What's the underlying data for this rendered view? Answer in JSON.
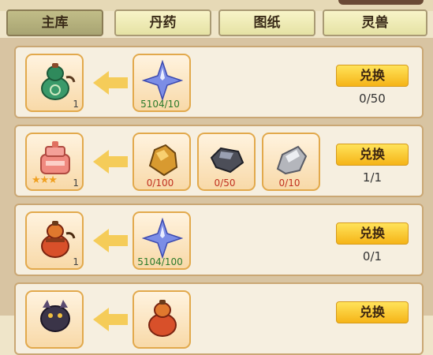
{
  "tabs": [
    {
      "label": "主库"
    },
    {
      "label": "丹药"
    },
    {
      "label": "图纸"
    },
    {
      "label": "灵兽"
    }
  ],
  "rows": [
    {
      "target": {
        "icon": "green-gourd-icon",
        "qty": "1"
      },
      "materials": [
        {
          "icon": "blue-crystal-icon",
          "count": "5104/10"
        }
      ],
      "button": "兑换",
      "progress": "0/50"
    },
    {
      "target": {
        "icon": "pink-furnace-icon",
        "qty": "1",
        "stars": "★★★"
      },
      "materials": [
        {
          "icon": "gold-ore-icon",
          "count": "0/100"
        },
        {
          "icon": "dark-ore-icon",
          "count": "0/50"
        },
        {
          "icon": "silver-ore-icon",
          "count": "0/10"
        }
      ],
      "button": "兑换",
      "progress": "1/1"
    },
    {
      "target": {
        "icon": "red-gourd-icon",
        "qty": "1"
      },
      "materials": [
        {
          "icon": "blue-crystal-icon",
          "count": "5104/100"
        }
      ],
      "button": "兑换",
      "progress": "0/1"
    },
    {
      "target": {
        "icon": "dark-beast-icon"
      },
      "materials": [
        {
          "icon": "red-gourd-icon"
        }
      ],
      "button": "兑换"
    }
  ],
  "colors": {
    "accent": "#f5b417",
    "panel": "#f6efe0",
    "slot_border": "#e2a94c"
  }
}
